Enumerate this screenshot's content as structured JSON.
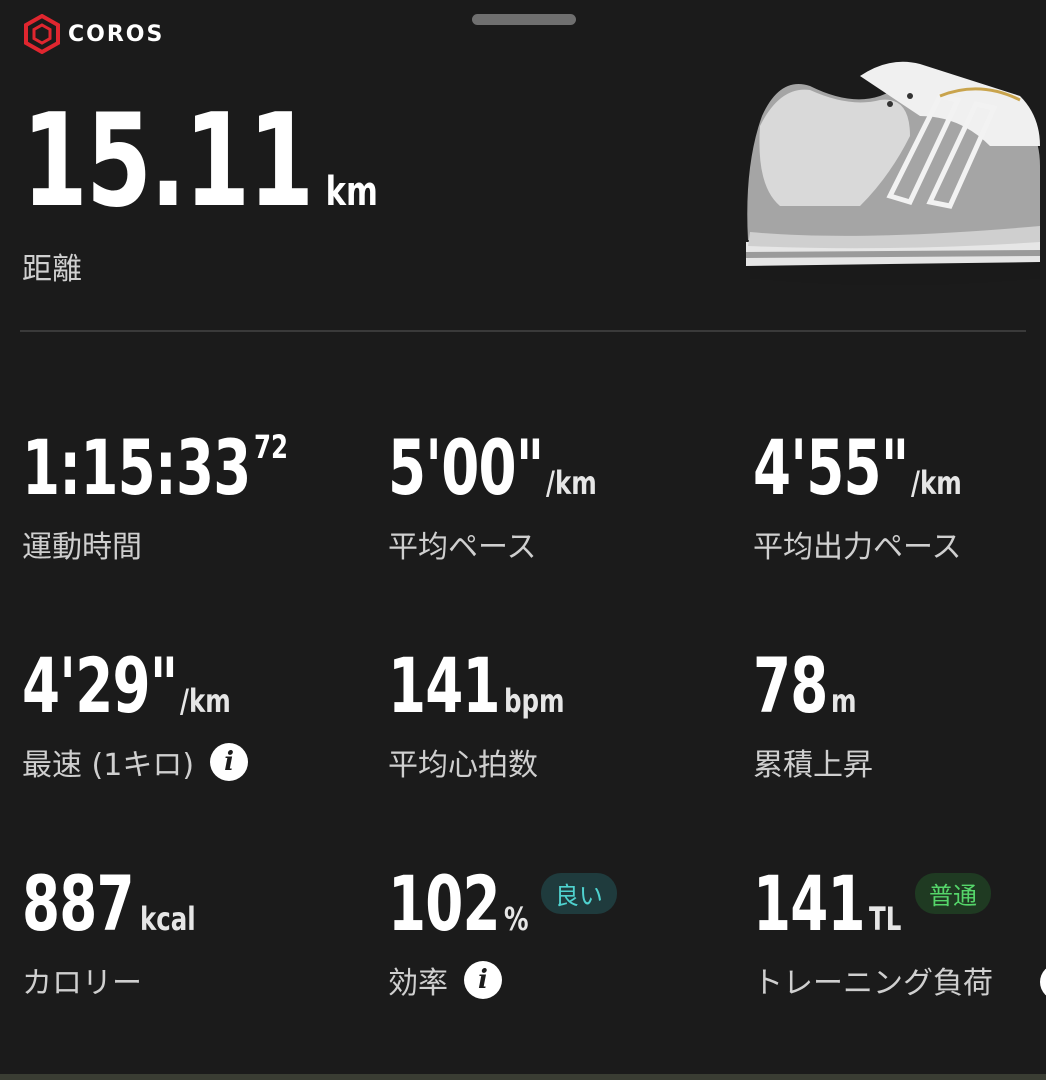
{
  "brand": {
    "name": "COROS",
    "accent": "#e0262f"
  },
  "hero": {
    "value": "15.11",
    "unit": "km",
    "label": "距離"
  },
  "stats": {
    "time": {
      "value": "1:15:33",
      "sup": "72",
      "label": "運動時間"
    },
    "avg_pace": {
      "value": "5'00\"",
      "unit": "/km",
      "label": "平均ペース"
    },
    "avg_power_pace": {
      "value": "4'55\"",
      "unit": "/km",
      "label": "平均出力ペース"
    },
    "fastest_km": {
      "value": "4'29\"",
      "unit": "/km",
      "label": "最速 (1キロ)",
      "icon": "info-icon"
    },
    "avg_hr": {
      "value": "141",
      "unit": "bpm",
      "label": "平均心拍数"
    },
    "elevation_gain": {
      "value": "78",
      "unit": "m",
      "label": "累積上昇"
    },
    "calories": {
      "value": "887",
      "unit": "kcal",
      "label": "カロリー"
    },
    "efficiency": {
      "value": "102",
      "unit": "%",
      "badge": "良い",
      "label": "効率",
      "icon": "info-icon"
    },
    "training_load": {
      "value": "141",
      "unit": "TL",
      "badge": "普通",
      "label": "トレーニング負荷"
    }
  },
  "colors": {
    "background": "#1b1b1b",
    "badge_good_text": "#4fd2cf",
    "badge_normal_text": "#55d66a"
  }
}
